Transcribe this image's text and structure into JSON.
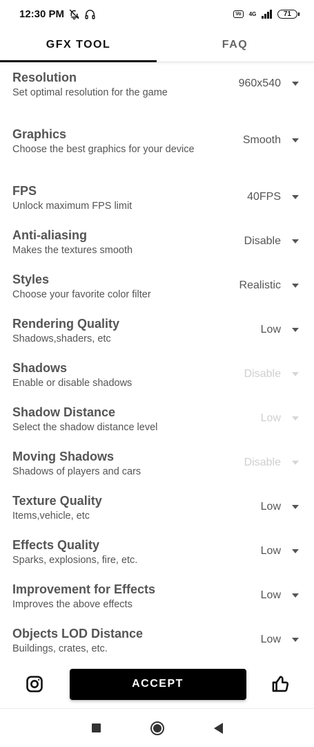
{
  "status_bar": {
    "time": "12:30 PM",
    "network": "4G",
    "battery": "71"
  },
  "tabs": [
    {
      "label": "GFX TOOL",
      "active": true
    },
    {
      "label": "FAQ",
      "active": false
    }
  ],
  "settings": [
    {
      "title": "Resolution",
      "description": "Set optimal resolution for the game",
      "value": "960x540",
      "enabled": true
    },
    {
      "title": "Graphics",
      "description": "Choose the best graphics for your device",
      "value": "Smooth",
      "enabled": true
    },
    {
      "title": "FPS",
      "description": "Unlock maximum FPS limit",
      "value": "40FPS",
      "enabled": true
    },
    {
      "title": "Anti-aliasing",
      "description": "Makes the textures smooth",
      "value": "Disable",
      "enabled": true
    },
    {
      "title": "Styles",
      "description": "Choose your favorite color filter",
      "value": "Realistic",
      "enabled": true
    },
    {
      "title": "Rendering Quality",
      "description": "Shadows,shaders, etc",
      "value": "Low",
      "enabled": true
    },
    {
      "title": "Shadows",
      "description": "Enable or disable shadows",
      "value": "Disable",
      "enabled": false
    },
    {
      "title": "Shadow Distance",
      "description": "Select the shadow distance level",
      "value": "Low",
      "enabled": false
    },
    {
      "title": "Moving Shadows",
      "description": "Shadows of players and cars",
      "value": "Disable",
      "enabled": false
    },
    {
      "title": "Texture Quality",
      "description": "Items,vehicle, etc",
      "value": "Low",
      "enabled": true
    },
    {
      "title": "Effects Quality",
      "description": "Sparks, explosions, fire, etc.",
      "value": "Low",
      "enabled": true
    },
    {
      "title": "Improvement for Effects",
      "description": "Improves the above effects",
      "value": "Low",
      "enabled": true
    },
    {
      "title": "Objects LOD Distance",
      "description": "Buildings, crates, etc.",
      "value": "Low",
      "enabled": true
    }
  ],
  "bottom_bar": {
    "accept_label": "ACCEPT",
    "left_icon": "instagram-icon",
    "right_icon": "thumbs-up-icon"
  },
  "colors": {
    "accent": "#000000",
    "text": "#555555",
    "disabled": "#cfcfcf"
  }
}
